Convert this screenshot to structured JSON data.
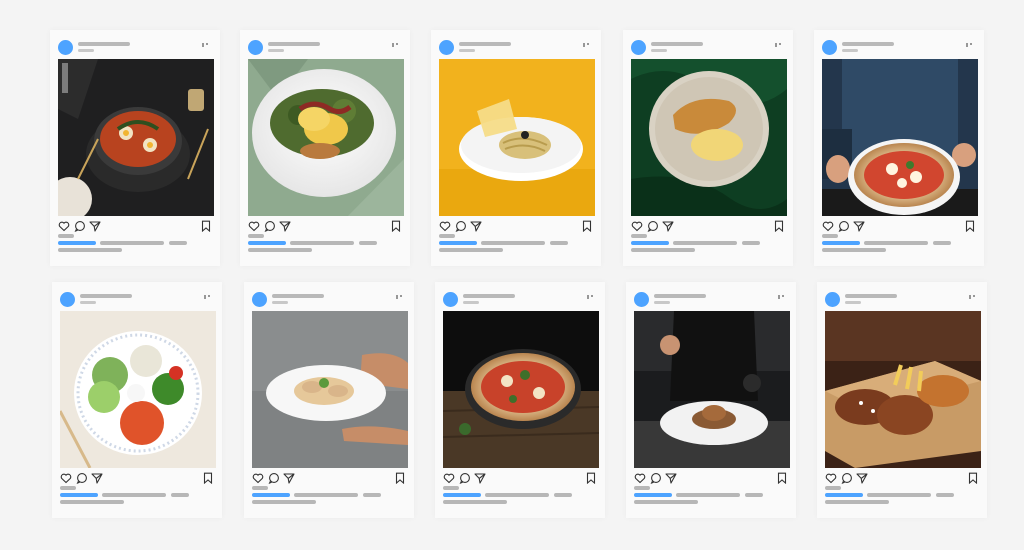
{
  "colors": {
    "accent": "#4da3ff",
    "placeholder": "#b9b9b9",
    "background": "#f4f4f4",
    "card": "#fafafa"
  },
  "post_icons": [
    "heart-icon",
    "comment-icon",
    "share-icon",
    "bookmark-icon"
  ],
  "posts": [
    {
      "dish": "shakshuka-skillet"
    },
    {
      "dish": "eggs-benedict-salad"
    },
    {
      "dish": "pasta-with-parmesan-crisp"
    },
    {
      "dish": "schnitzel-with-scrambled-eggs"
    },
    {
      "dish": "margherita-pizza-held"
    },
    {
      "dish": "poke-bowl"
    },
    {
      "dish": "dumplings-plate-held"
    },
    {
      "dish": "pizza-on-wooden-table"
    },
    {
      "dish": "chef-plated-dish"
    },
    {
      "dish": "fried-chicken-fries-box"
    }
  ]
}
